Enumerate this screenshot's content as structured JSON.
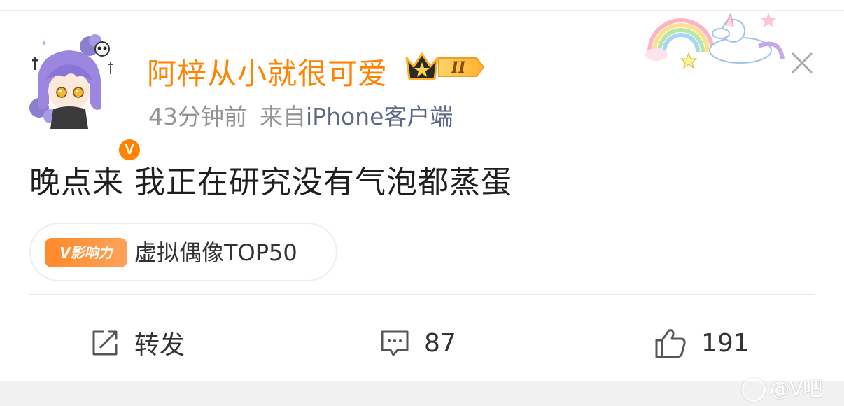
{
  "post": {
    "username": "阿梓从小就很可爱",
    "member_level": "II",
    "time": "43分钟前",
    "source_prefix": "来自",
    "source": "iPhone客户端",
    "verified_mark": "V",
    "text": "晚点来 我正在研究没有气泡都蒸蛋",
    "influence_tag": "V影响力",
    "influence_label": "虚拟偶像TOP50"
  },
  "actions": {
    "repost_label": "转发",
    "comment_count": "87",
    "like_count": "191"
  },
  "watermark": {
    "text": "@V吧"
  },
  "colors": {
    "username": "#ff8200",
    "source_link": "#5d6a85",
    "meta": "#939393",
    "badge": "#ff8200"
  },
  "icons": {
    "close": "close-icon",
    "repost": "share-edit-icon",
    "comment": "comment-icon",
    "like": "thumbs-up-icon",
    "crown": "crown-badge-icon"
  }
}
